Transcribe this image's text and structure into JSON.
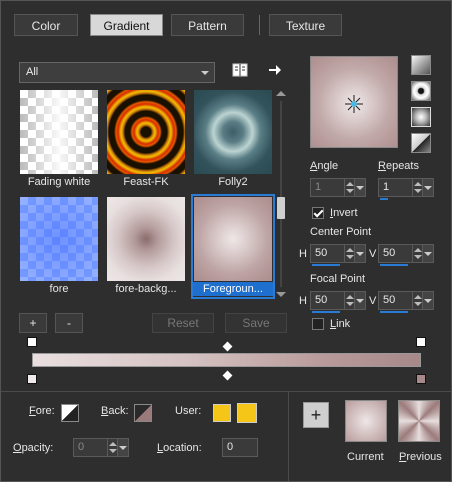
{
  "tabs": [
    {
      "label": "Color",
      "active": false
    },
    {
      "label": "Gradient",
      "active": true
    },
    {
      "label": "Pattern",
      "active": false
    },
    {
      "label": "Texture",
      "active": false
    }
  ],
  "category_dropdown": {
    "value": "All"
  },
  "icons": {
    "library": "open-book-icon",
    "export": "arrow-right-icon"
  },
  "gradients": [
    {
      "name": "Fading white",
      "selected": false
    },
    {
      "name": "Feast-FK",
      "selected": false
    },
    {
      "name": "Folly2",
      "selected": false
    },
    {
      "name": "fore",
      "selected": false
    },
    {
      "name": "fore-backg...",
      "selected": false
    },
    {
      "name": "Foregroun...",
      "selected": true
    }
  ],
  "list_buttons": {
    "add": "+",
    "remove": "-",
    "reset": "Reset",
    "save": "Save"
  },
  "angle": {
    "label": "Angle",
    "value": "1"
  },
  "repeats": {
    "label": "Repeats",
    "value": "1"
  },
  "invert": {
    "label": "Invert",
    "checked": true
  },
  "center_point": {
    "label": "Center Point",
    "h_label": "H",
    "h_value": "50",
    "v_label": "V",
    "v_value": "50"
  },
  "focal_point": {
    "label": "Focal Point",
    "h_label": "H",
    "h_value": "50",
    "v_label": "V",
    "v_value": "50"
  },
  "link": {
    "label": "Link",
    "checked": false
  },
  "fore": {
    "label": "Fore:"
  },
  "back": {
    "label": "Back:"
  },
  "user": {
    "label": "User:",
    "color": "#f5c518"
  },
  "opacity": {
    "label": "Opacity:",
    "value": "0"
  },
  "location": {
    "label": "Location:",
    "value": "0"
  },
  "bottom_previews": {
    "add": "+",
    "current": "Current",
    "previous": "Previous"
  },
  "colors": {
    "accent": "#2a7bd6",
    "gradient_light": "#eadfe0",
    "gradient_dark": "#a78989",
    "user_yellow": "#f5c518"
  }
}
